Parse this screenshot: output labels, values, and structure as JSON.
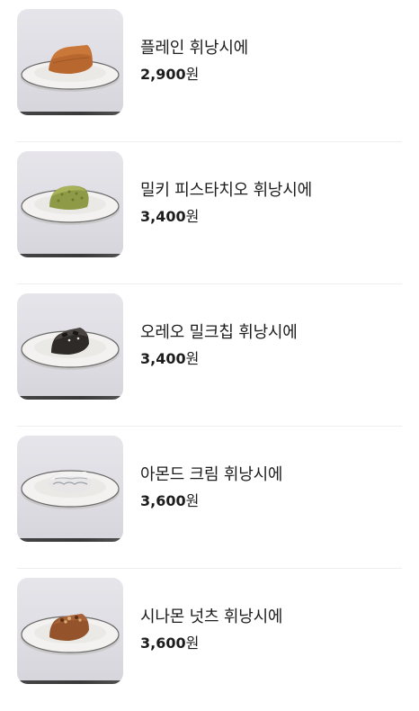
{
  "menu": {
    "items": [
      {
        "name": "플레인 휘낭시에",
        "price": "2,900",
        "currency": "원",
        "image_alt": "plain-financier-photo",
        "cake_color": "#b8682e",
        "cake_top_color": "#c9783a"
      },
      {
        "name": "밀키 피스타치오 휘낭시에",
        "price": "3,400",
        "currency": "원",
        "image_alt": "milky-pistachio-financier-photo",
        "cake_color": "#8e9a45",
        "cake_top_color": "#a9b25a"
      },
      {
        "name": "오레오 밀크칩 휘낭시에",
        "price": "3,400",
        "currency": "원",
        "image_alt": "oreo-milk-chip-financier-photo",
        "cake_color": "#2e2a28",
        "cake_top_color": "#4a4542"
      },
      {
        "name": "아몬드 크림 휘낭시에",
        "price": "3,600",
        "currency": "원",
        "image_alt": "almond-cream-financier-photo",
        "cake_color": "#e8e6e6",
        "cake_top_color": "#f4f3f3"
      },
      {
        "name": "시나몬 넛츠 휘낭시에",
        "price": "3,600",
        "currency": "원",
        "image_alt": "cinnamon-nuts-financier-photo",
        "cake_color": "#94532a",
        "cake_top_color": "#a86238"
      }
    ]
  }
}
